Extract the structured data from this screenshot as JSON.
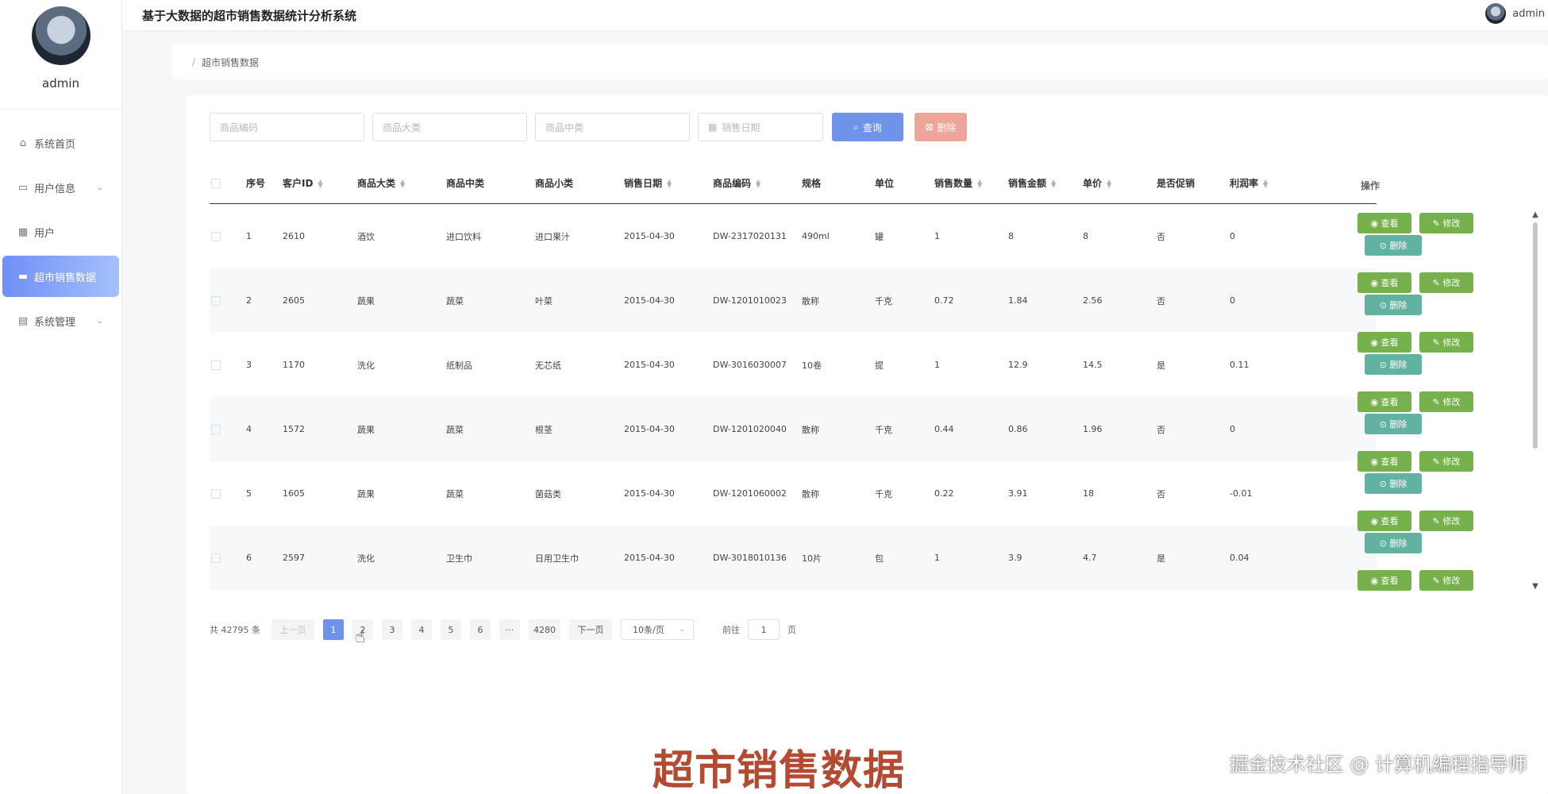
{
  "app": {
    "title": "基于大数据的超市销售数据统计分析系统",
    "user_name": "admin"
  },
  "sidebar": {
    "user_name": "admin",
    "items": [
      {
        "label": "系统首页",
        "icon": "home-icon"
      },
      {
        "label": "用户信息",
        "icon": "id-card-icon",
        "chevron": "⌄"
      },
      {
        "label": "用户",
        "icon": "grid-icon"
      },
      {
        "label": "超市销售数据",
        "icon": "chat-icon",
        "active": true
      },
      {
        "label": "系统管理",
        "icon": "server-icon",
        "chevron": "⌄"
      }
    ]
  },
  "breadcrumb": {
    "separator": "/",
    "current": "超市销售数据"
  },
  "search": {
    "product_code_placeholder": "商品编码",
    "category_placeholder": "商品大类",
    "subcategory_placeholder": "商品中类",
    "date_placeholder": "销售日期",
    "query_label": "查询",
    "delete_label": "删除"
  },
  "table": {
    "headers": {
      "index": "序号",
      "customer_id": "客户ID",
      "category": "商品大类",
      "mid_category": "商品中类",
      "sub_category": "商品小类",
      "sale_date": "销售日期",
      "product_code": "商品编码",
      "spec": "规格",
      "unit": "单位",
      "quantity": "销售数量",
      "amount": "销售金额",
      "price": "单价",
      "promotion": "是否促销",
      "profit_rate": "利润率",
      "operations": "操作"
    },
    "rows": [
      {
        "idx": "1",
        "cid": "2610",
        "cat": "酒饮",
        "mid": "进口饮料",
        "sub": "进口果汁",
        "date": "2015-04-30",
        "code": "DW-2317020131",
        "spec": "490ml",
        "unit": "罐",
        "qty": "1",
        "amount": "8",
        "price": "8",
        "promo": "否",
        "profit": "0"
      },
      {
        "idx": "2",
        "cid": "2605",
        "cat": "蔬果",
        "mid": "蔬菜",
        "sub": "叶菜",
        "date": "2015-04-30",
        "code": "DW-1201010023",
        "spec": "散称",
        "unit": "千克",
        "qty": "0.72",
        "amount": "1.84",
        "price": "2.56",
        "promo": "否",
        "profit": "0"
      },
      {
        "idx": "3",
        "cid": "1170",
        "cat": "洗化",
        "mid": "纸制品",
        "sub": "无芯纸",
        "date": "2015-04-30",
        "code": "DW-3016030007",
        "spec": "10卷",
        "unit": "提",
        "qty": "1",
        "amount": "12.9",
        "price": "14.5",
        "promo": "是",
        "profit": "0.11"
      },
      {
        "idx": "4",
        "cid": "1572",
        "cat": "蔬果",
        "mid": "蔬菜",
        "sub": "根茎",
        "date": "2015-04-30",
        "code": "DW-1201020040",
        "spec": "散称",
        "unit": "千克",
        "qty": "0.44",
        "amount": "0.86",
        "price": "1.96",
        "promo": "否",
        "profit": "0"
      },
      {
        "idx": "5",
        "cid": "1605",
        "cat": "蔬果",
        "mid": "蔬菜",
        "sub": "菌菇类",
        "date": "2015-04-30",
        "code": "DW-1201060002",
        "spec": "散称",
        "unit": "千克",
        "qty": "0.22",
        "amount": "3.91",
        "price": "18",
        "promo": "否",
        "profit": "-0.01"
      },
      {
        "idx": "6",
        "cid": "2597",
        "cat": "洗化",
        "mid": "卫生巾",
        "sub": "日用卫生巾",
        "date": "2015-04-30",
        "code": "DW-3018010136",
        "spec": "10片",
        "unit": "包",
        "qty": "1",
        "amount": "3.9",
        "price": "4.7",
        "promo": "是",
        "profit": "0.04"
      }
    ],
    "actions": {
      "view": "查看",
      "edit": "修改",
      "delete": "删除"
    }
  },
  "pagination": {
    "total": "共 42795 条",
    "prev": "上一页",
    "pages": [
      "1",
      "2",
      "3",
      "4",
      "5",
      "6"
    ],
    "ellipsis": "···",
    "last": "4280",
    "next": "下一页",
    "page_size": "10条/页",
    "goto_label": "前往",
    "goto_value": "1",
    "goto_suffix": "页",
    "current_page": 1
  },
  "overlay": {
    "caption": "超市销售数据",
    "watermark": "掘金技术社区 @ 计算机编程指导师"
  },
  "colors": {
    "primary": "#6f93e9",
    "danger_light": "#eea599",
    "action_green": "#77b14d",
    "action_teal": "#61b2a1",
    "caption_red": "#b24b32"
  }
}
